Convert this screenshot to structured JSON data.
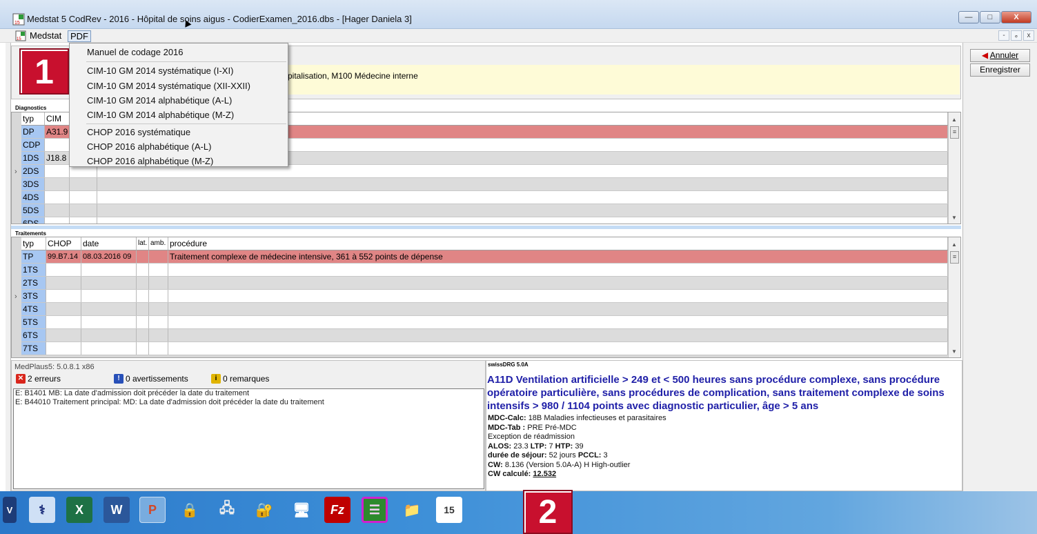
{
  "window": {
    "title": "Medstat 5 CodRev - 2016 - Hôpital de soins aigus - CodierExamen_2016.dbs - [Hager Daniela 3]",
    "buttons": {
      "minimize": "—",
      "maximize": "□",
      "close": "X"
    }
  },
  "menubar": {
    "items": [
      "Medstat",
      "PDF"
    ],
    "mdi": [
      "-",
      "ₑ",
      "x"
    ]
  },
  "pdf_menu": {
    "items": [
      "Manuel de codage 2016",
      "CIM-10 GM 2014 systématique (I-XI)",
      "CIM-10 GM 2014 systématique (XII-XXII)",
      "CIM-10 GM 2014 alphabétique (A-L)",
      "CIM-10 GM 2014 alphabétique (M-Z)",
      "CHOP 2016 systématique",
      "CHOP 2016 alphabétique (A-L)",
      "CHOP 2016 alphabétique (M-Z)"
    ]
  },
  "right_panel": {
    "cancel": "Annuler",
    "save": "Enregistrer"
  },
  "case": {
    "info_text": "pitalisation, M100 Médecine interne"
  },
  "diagnostics": {
    "label": "Diagnostics",
    "headers": {
      "typ": "typ",
      "cim": "CIM"
    },
    "rows": [
      {
        "typ": "DP",
        "cim": "A31.9"
      },
      {
        "typ": "CDP",
        "cim": ""
      },
      {
        "typ": "1DS",
        "cim": "J18.8"
      },
      {
        "typ": "2DS",
        "cim": ""
      },
      {
        "typ": "3DS",
        "cim": ""
      },
      {
        "typ": "4DS",
        "cim": ""
      },
      {
        "typ": "5DS",
        "cim": ""
      },
      {
        "typ": "6DS",
        "cim": ""
      }
    ]
  },
  "traitements": {
    "label": "Traitements",
    "headers": {
      "typ": "typ",
      "chop": "CHOP",
      "date": "date",
      "lat": "lat.",
      "amb": "amb.",
      "procedure": "procédure"
    },
    "rows": [
      {
        "typ": "TP",
        "chop": "99.B7.14",
        "date": "08.03.2016 09",
        "procedure": "Traitement complexe de médecine intensive, 361 à 552 points de dépense"
      },
      {
        "typ": "1TS",
        "chop": "",
        "date": "",
        "procedure": ""
      },
      {
        "typ": "2TS",
        "chop": "",
        "date": "",
        "procedure": ""
      },
      {
        "typ": "3TS",
        "chop": "",
        "date": "",
        "procedure": ""
      },
      {
        "typ": "4TS",
        "chop": "",
        "date": "",
        "procedure": ""
      },
      {
        "typ": "5TS",
        "chop": "",
        "date": "",
        "procedure": ""
      },
      {
        "typ": "6TS",
        "chop": "",
        "date": "",
        "procedure": ""
      },
      {
        "typ": "7TS",
        "chop": "",
        "date": "",
        "procedure": ""
      }
    ]
  },
  "medplaus": {
    "legend": "MedPlaus5: 5.0.8.1 x86",
    "errors": "2 erreurs",
    "warnings": "0 avertissements",
    "remarks": "0 remarques",
    "messages": [
      "E: B1401 MB: La date d'admission doit précéder la date du traitement",
      "E: B44010 Traitement principal: MD: La date d'admission doit précéder la date du traitement"
    ]
  },
  "drg": {
    "legend": "swissDRG 5.0A",
    "title": "A11D Ventilation artificielle > 249 et < 500 heures sans procédure complexe, sans procédure opératoire particulière, sans procédures de complication, sans traitement complexe de soins intensifs > 980 / 1104 points avec diagnostic particulier, âge > 5 ans",
    "mdc_calc_label": "MDC-Calc:",
    "mdc_calc": "18B Maladies infectieuses et parasitaires",
    "mdc_tab_label": "MDC-Tab :",
    "mdc_tab": "PRE Pré-MDC",
    "readmission": "Exception de réadmission",
    "alos_label": "ALOS:",
    "alos": "23.3",
    "ltp_label": "LTP:",
    "ltp": "7",
    "htp_label": "HTP:",
    "htp": "39",
    "duree_label": "durée de séjour:",
    "duree": "52 jours",
    "pccl_label": "PCCL:",
    "pccl": "3",
    "cw_label": "CW:",
    "cw": "8.136 (Version 5.0A-A) H High-outlier",
    "cw_calc_label": "CW calculé:",
    "cw_calc": "12.532"
  },
  "callouts": {
    "one": "1",
    "two": "2"
  },
  "taskbar": {
    "apps": [
      "V",
      "⚕",
      "X",
      "W",
      "P",
      "🔒",
      "🖧",
      "🔐",
      "🖥",
      "Fz",
      "☰",
      "📁",
      "15"
    ],
    "colors": {
      "excel": "#1e7145",
      "word": "#2b579a",
      "ppt": "#d24726",
      "filezilla": "#bf0000"
    }
  }
}
